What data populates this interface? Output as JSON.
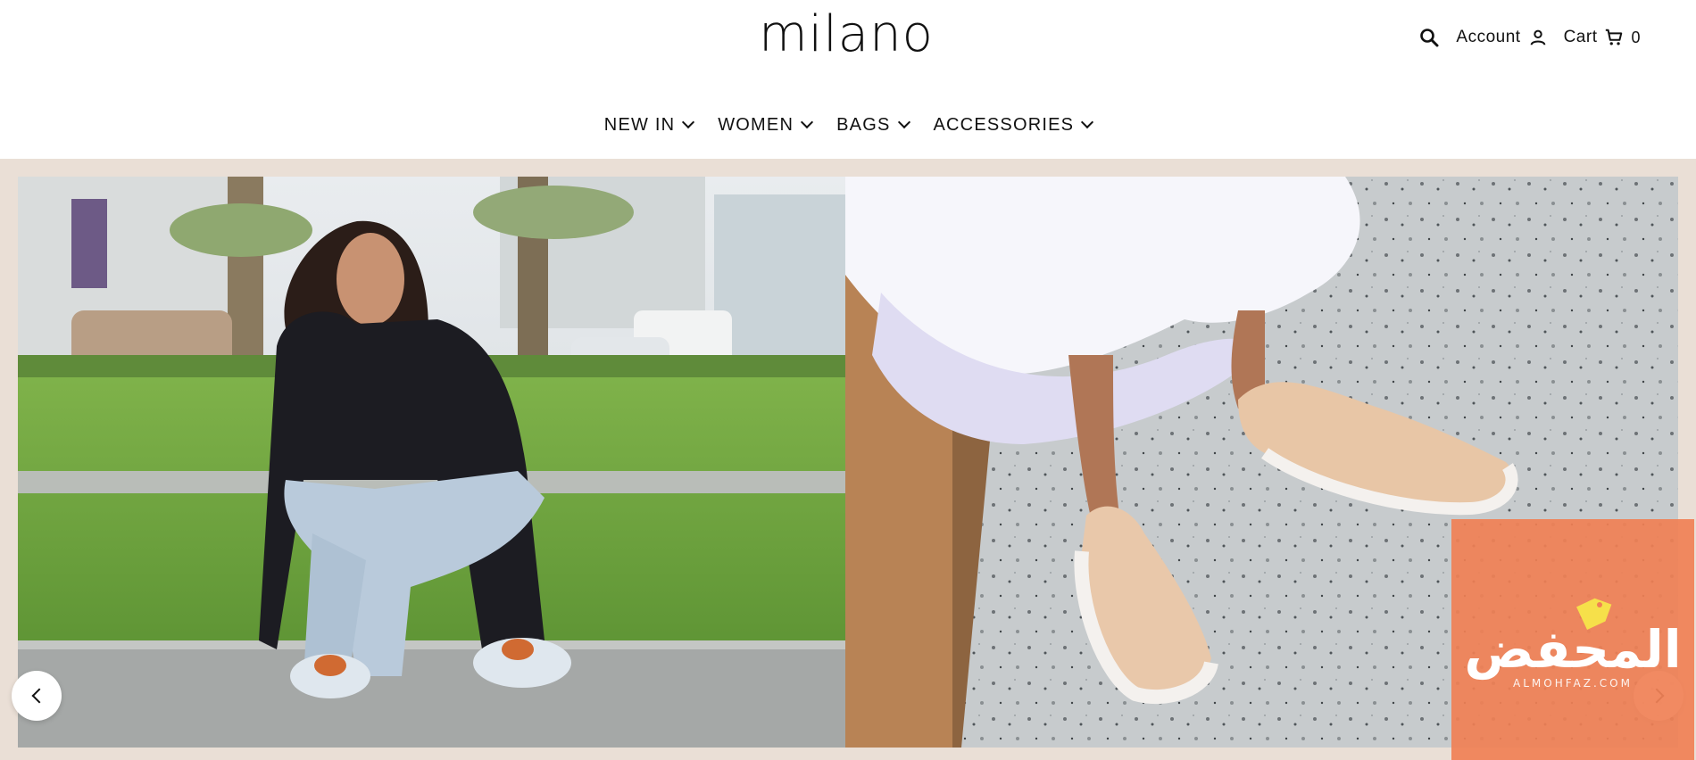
{
  "header": {
    "logo": "milano",
    "search_icon": "search-icon",
    "account_label": "Account",
    "account_icon": "person-icon",
    "cart_label": "Cart",
    "cart_icon": "cart-icon",
    "cart_count": "0"
  },
  "nav": {
    "items": [
      {
        "label": "NEW IN",
        "icon": "chevron-down-icon"
      },
      {
        "label": "WOMEN",
        "icon": "chevron-down-icon"
      },
      {
        "label": "BAGS",
        "icon": "chevron-down-icon"
      },
      {
        "label": "ACCESSORIES",
        "icon": "chevron-down-icon"
      }
    ]
  },
  "hero": {
    "prev_icon": "chevron-left-icon",
    "next_icon": "chevron-right-icon",
    "background_color": "#eadfd6"
  },
  "watermark": {
    "arabic_text": "المحفض",
    "latin_text": "ALMOHFAZ.COM",
    "color": "#f08055"
  }
}
